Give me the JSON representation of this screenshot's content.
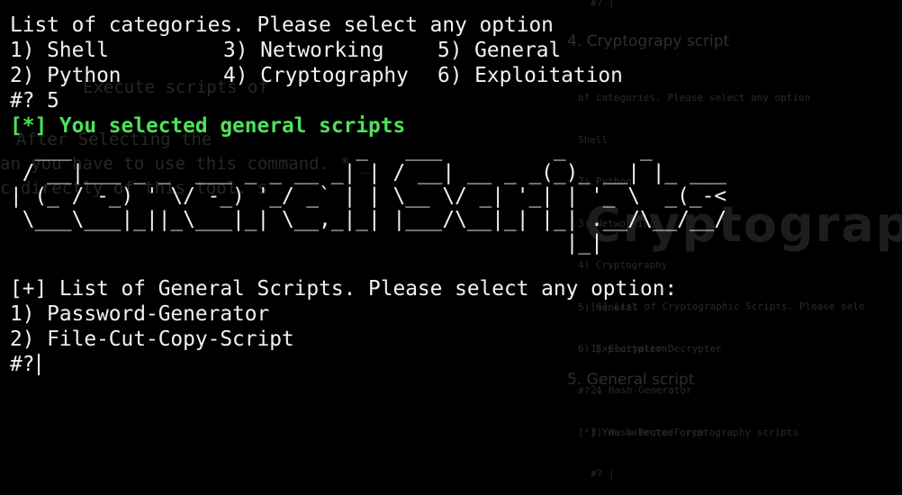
{
  "ghost": {
    "prompt_top": "#? |",
    "heading_crypto": "4. Cryptograpy script",
    "ghost_mid_1": "Execute scripts of",
    "ghost_mid_2": "After Selecting the",
    "ghost_mid_3": "an you have to use this command. * _",
    "ghost_mid_4": "c directly of this tool. s",
    "lines": [
      "of categories. Please select any option",
      "Shell",
      "2) Python",
      "3) Networking",
      "4) Cryptography",
      "5) General",
      "6) Exploitation",
      "#? 4",
      "[*] You selected cryptography scripts"
    ],
    "lines_lower": [
      "[+] List of Cryptographic Scripts. Please sele",
      "1) Encrypter-Decrypter",
      "2) Hash-Generator",
      "3) Hash-Brute-Force",
      "#? |"
    ],
    "banner_text": "Cryptograp",
    "heading_general": "5. General script"
  },
  "terminal": {
    "categories_prompt": "List of categories. Please select any option",
    "menu": [
      [
        "1) Shell",
        "3) Networking",
        "5) General"
      ],
      [
        "2) Python",
        "4) Cryptography",
        "6) Exploitation"
      ]
    ],
    "first_input": "#? 5",
    "selected_message": "[*] You selected general scripts",
    "banner_ascii": [
      "  ___                       _   ___         _      _",
      " / __|___ _ _  ___ _ _ __ _| | / __| __ _ _(_)_ __| |_ ___",
      "| (_ / -_) ' \\/ -_) '_/ _` | | \\__ \\/ _| '_| | '_ \\  _(_-<",
      " \\___\\___|_||_\\___|_| \\__,_|_| |___/\\__|_| |_| .__/\\__/__/",
      "                                             |_|"
    ],
    "general_list_prompt": "[+] List of General Scripts. Please select any option:",
    "general_items": [
      "1) Password-Generator",
      "2) File-Cut-Copy-Script"
    ],
    "second_input": "#?"
  },
  "colors": {
    "background": "#000000",
    "text": "#f2f2f2",
    "accent_green": "#4fe15a"
  }
}
